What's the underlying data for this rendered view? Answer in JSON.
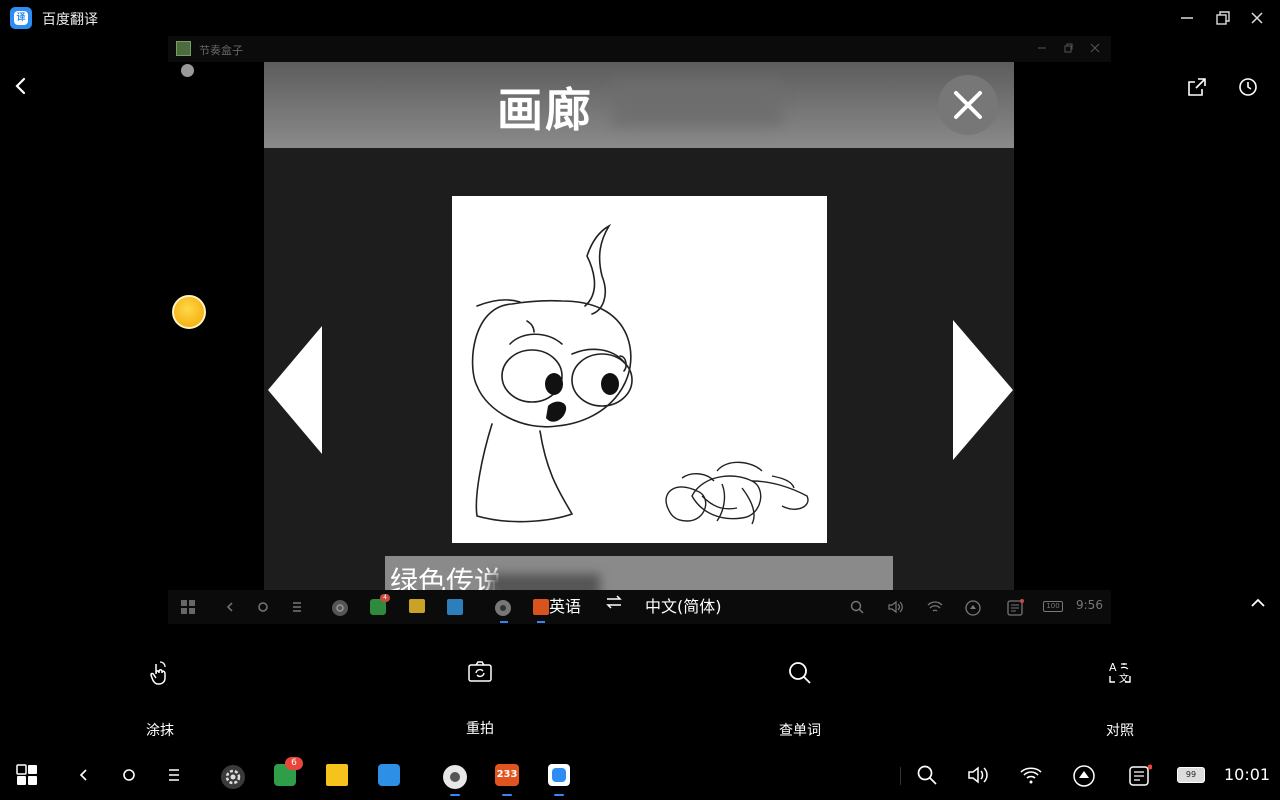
{
  "window": {
    "title": "百度翻译",
    "inner_title": "节奏盒子"
  },
  "game": {
    "title": "画廊",
    "caption": "绿色传说"
  },
  "language": {
    "source": "英语",
    "target": "中文(简体)",
    "swap_icon": "swap-arrows-icon"
  },
  "tools": [
    {
      "label": "涂抹",
      "icon": "hand-smear-icon"
    },
    {
      "label": "重拍",
      "icon": "camera-retake-icon"
    },
    {
      "label": "查单词",
      "icon": "search-icon"
    },
    {
      "label": "对照",
      "icon": "translate-compare-icon"
    }
  ],
  "inner_taskbar": {
    "clock": "9:56",
    "battery": "100",
    "badge_count": "4"
  },
  "taskbar": {
    "clock": "10:01",
    "battery": "99",
    "badge_count": "6",
    "app_233_label": "233"
  },
  "colors": {
    "accent": "#3b82f6",
    "badge": "#e9473b",
    "app_blue": "#2f8cf0"
  }
}
